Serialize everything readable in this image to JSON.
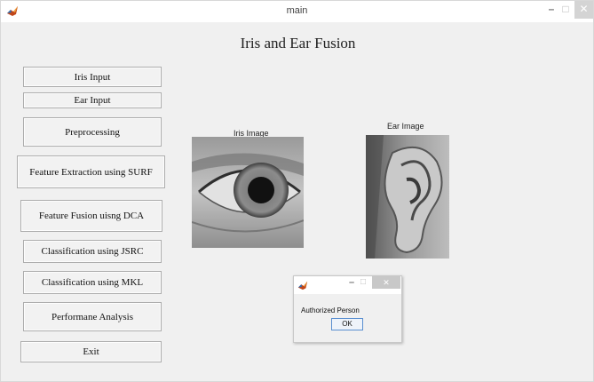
{
  "window": {
    "title": "main",
    "controls": {
      "minimize": "–",
      "maximize": "□",
      "close": "✕"
    }
  },
  "heading": "Iris and Ear Fusion",
  "buttons": {
    "iris_input": "Iris Input",
    "ear_input": "Ear Input",
    "preprocessing": "Preprocessing",
    "feature_extraction": "Feature Extraction using SURF",
    "feature_fusion": "Feature Fusion uisng DCA",
    "classification_jsrc": "Classification using JSRC",
    "classification_mkl": "Classification using MKL",
    "performance": "Performane Analysis",
    "exit": "Exit"
  },
  "panels": {
    "iris_label": "Iris Image",
    "ear_label": "Ear Image"
  },
  "dialog": {
    "message": "Authorized Person",
    "ok_label": "OK",
    "controls": {
      "minimize": "–",
      "maximize": "□",
      "close": "✕"
    }
  },
  "icons": {
    "app": "matlab-logo-icon",
    "dialog_app": "matlab-logo-icon"
  }
}
